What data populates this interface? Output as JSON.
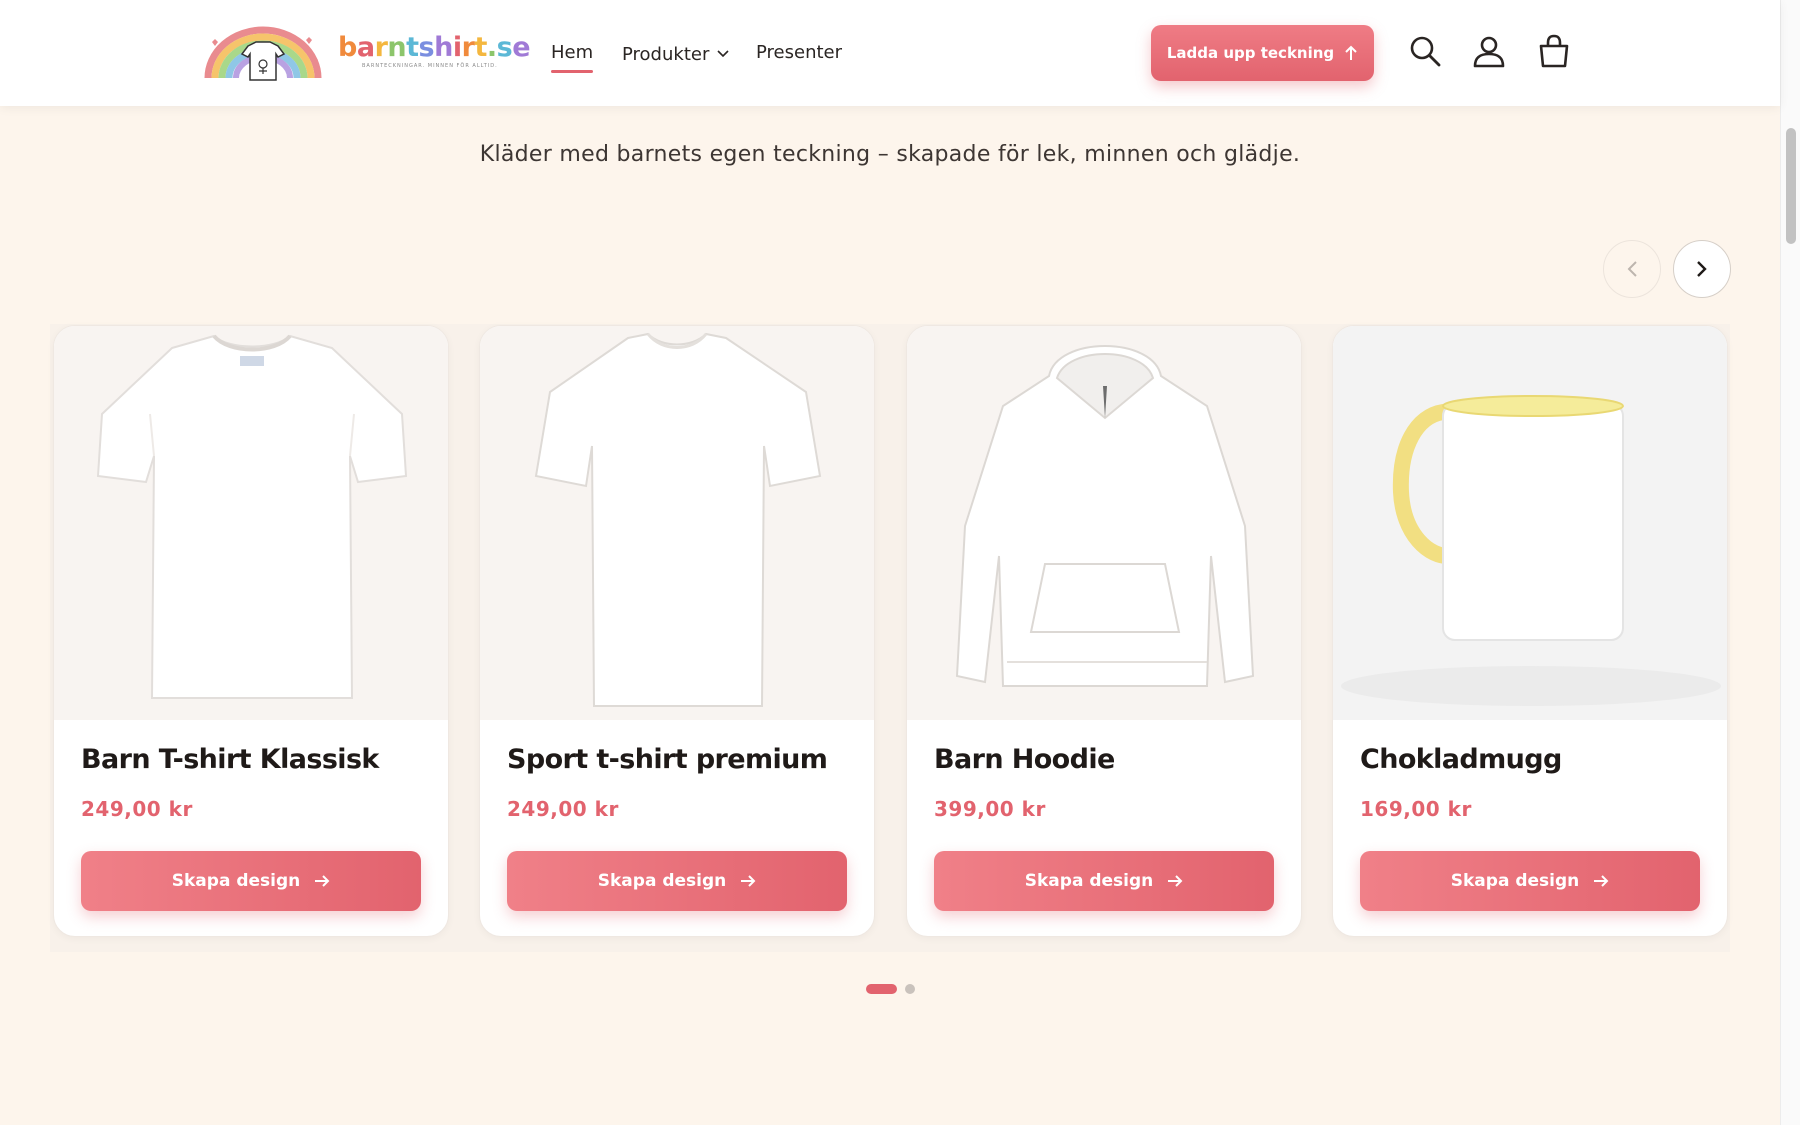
{
  "header": {
    "logo_text_parts": [
      "b",
      "a",
      "r",
      "n",
      "t",
      "s",
      "h",
      "i",
      "r",
      "t",
      ".",
      "s",
      "e"
    ],
    "logo_colors": [
      "#f08a3c",
      "#e2636e",
      "#f4b73f",
      "#8cc56b",
      "#5cb8d6",
      "#7a8ee0",
      "#a07ad6",
      "#e2636e",
      "#f08a3c",
      "#f4b73f",
      "#8cc56b",
      "#5cb8d6",
      "#a07ad6"
    ],
    "logo_tagline": "BARNTECKNINGAR. MINNEN FÖR ALLTID.",
    "nav": {
      "home": "Hem",
      "products": "Produkter",
      "gifts": "Presenter"
    },
    "upload_button": "Ladda upp teckning"
  },
  "subtitle": "Kläder med barnets egen teckning – skapade för lek, minnen och glädje.",
  "products": [
    {
      "name": "Barn T-shirt Klassisk",
      "price": "249,00 kr",
      "button": "Skapa design",
      "image": "white-tshirt"
    },
    {
      "name": "Sport t-shirt premium",
      "price": "249,00 kr",
      "button": "Skapa design",
      "image": "white-sport-tshirt"
    },
    {
      "name": "Barn Hoodie",
      "price": "399,00 kr",
      "button": "Skapa design",
      "image": "white-hoodie"
    },
    {
      "name": "Chokladmugg",
      "price": "169,00 kr",
      "button": "Skapa design",
      "image": "yellow-mug"
    }
  ],
  "slider": {
    "pages": 2,
    "current_page": 1
  },
  "colors": {
    "accent": "#e2636e",
    "background": "#fdf5ec"
  },
  "icons": [
    "search-icon",
    "account-icon",
    "cart-icon",
    "chevron-left-icon",
    "chevron-right-icon",
    "arrow-up-icon",
    "arrow-right-icon",
    "chevron-down-icon"
  ]
}
